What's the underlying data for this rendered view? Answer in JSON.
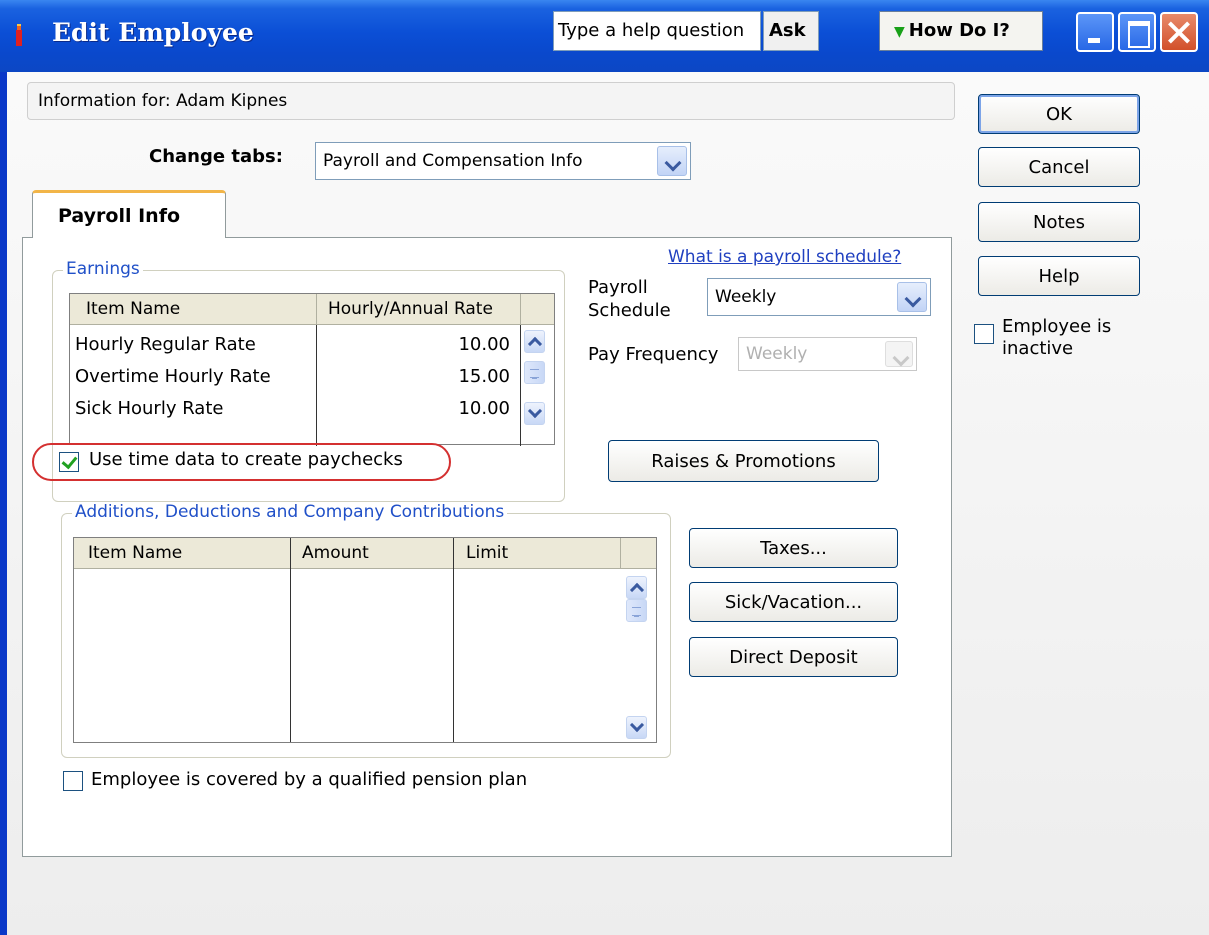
{
  "window": {
    "title": "Edit Employee",
    "help_placeholder": "Type a help question",
    "ask_label": "Ask",
    "how_do_i_label": "How Do I?"
  },
  "info": {
    "label": "Information for: Adam Kipnes"
  },
  "change_tabs": {
    "label": "Change tabs:",
    "selected": "Payroll and Compensation Info"
  },
  "tab": {
    "label": "Payroll Info"
  },
  "earnings": {
    "legend": "Earnings",
    "columns": [
      "Item Name",
      "Hourly/Annual Rate"
    ],
    "rows": [
      {
        "name": "Hourly Regular Rate",
        "rate": "10.00"
      },
      {
        "name": "Overtime Hourly Rate",
        "rate": "15.00"
      },
      {
        "name": "Sick Hourly Rate",
        "rate": "10.00"
      }
    ]
  },
  "payroll_schedule": {
    "link": "What is a payroll schedule?",
    "schedule_label_1": "Payroll",
    "schedule_label_2": "Schedule",
    "schedule_value": "Weekly",
    "frequency_label": "Pay Frequency",
    "frequency_value": "Weekly"
  },
  "use_time_data": {
    "label": "Use time data to create paychecks",
    "checked": true
  },
  "raises_button": "Raises & Promotions",
  "additions": {
    "legend": "Additions, Deductions and Company Contributions",
    "columns": [
      "Item Name",
      "Amount",
      "Limit"
    ]
  },
  "side_buttons": {
    "taxes": "Taxes...",
    "sick_vacation": "Sick/Vacation...",
    "direct_deposit": "Direct Deposit"
  },
  "pension": {
    "label": "Employee is covered by a qualified pension plan",
    "checked": false
  },
  "dialog_buttons": {
    "ok": "OK",
    "cancel": "Cancel",
    "notes": "Notes",
    "help": "Help"
  },
  "inactive": {
    "label_1": "Employee is",
    "label_2": "inactive",
    "checked": false
  },
  "colors": {
    "titlebar": "#0b4fd6",
    "link": "#2040c0",
    "highlight": "#d43030",
    "tab_accent": "#f2b548"
  }
}
